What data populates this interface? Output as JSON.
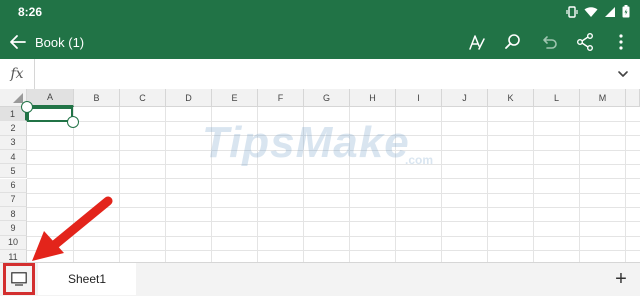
{
  "status": {
    "time": "8:26"
  },
  "appbar": {
    "title": "Book (1)"
  },
  "formula": {
    "fx_label": "fx",
    "value": ""
  },
  "grid": {
    "columns": [
      "A",
      "B",
      "C",
      "D",
      "E",
      "F",
      "G",
      "H",
      "I",
      "J",
      "K",
      "L",
      "M"
    ],
    "rows": [
      "1",
      "2",
      "3",
      "4",
      "5",
      "6",
      "7",
      "8",
      "9",
      "10",
      "11"
    ],
    "selected_cell": "A1"
  },
  "watermark": {
    "main": "TipsMake",
    "suffix": ".com"
  },
  "sheets": {
    "tabs": [
      "Sheet1"
    ],
    "add_label": "+"
  },
  "colors": {
    "accent": "#217346",
    "highlight": "#d32f2f"
  }
}
